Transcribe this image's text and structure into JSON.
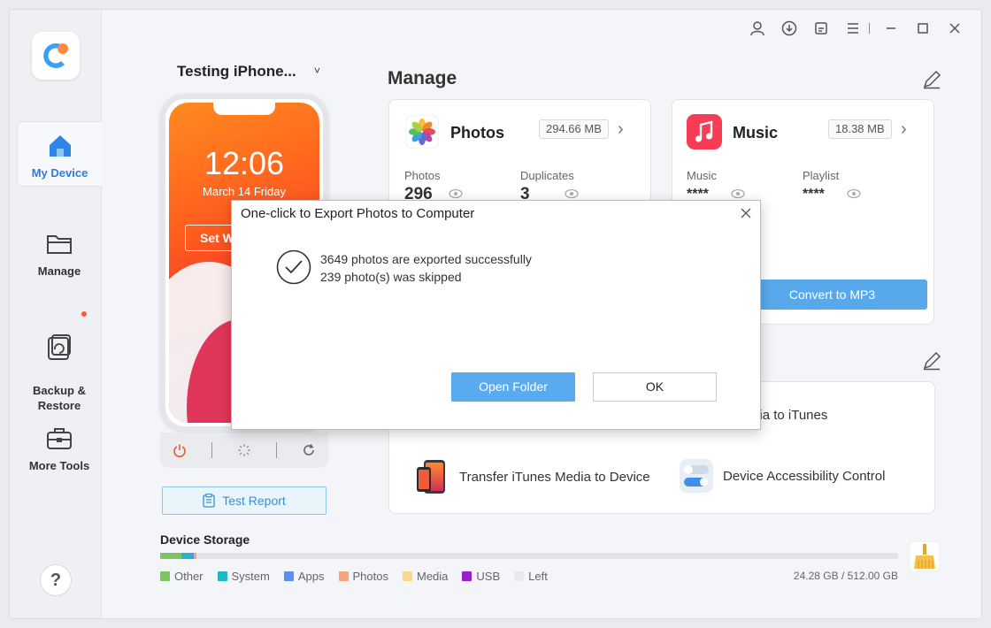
{
  "sidebar": {
    "logo_icon": "app-logo-icon",
    "items": [
      {
        "label": "My Device",
        "icon": "home-icon",
        "active": true
      },
      {
        "label": "Manage",
        "icon": "folder-icon"
      },
      {
        "label": "Backup &\nRestore",
        "icon": "backup-restore-icon",
        "badge": true
      },
      {
        "label": "More Tools",
        "icon": "toolbox-icon"
      }
    ],
    "help_label": "?"
  },
  "titlebar": {
    "icons": [
      "user-icon",
      "download-icon",
      "feedback-icon",
      "menu-icon",
      "minimize-icon",
      "maximize-icon",
      "close-icon"
    ]
  },
  "device": {
    "name": "Testing iPhone...",
    "caret": "˅",
    "time": "12:06",
    "date": "March 14 Friday",
    "screen_button": "Set W",
    "controls": [
      "power-icon",
      "loading-icon",
      "refresh-icon"
    ],
    "test_report_label": "Test Report"
  },
  "manage": {
    "title": "Manage",
    "photos_card": {
      "title": "Photos",
      "size": "294.66 MB",
      "stat1_label": "Photos",
      "stat1_value": "296",
      "stat2_label": "Duplicates",
      "stat2_value": "3"
    },
    "music_card": {
      "title": "Music",
      "size": "18.38 MB",
      "stat1_label": "Music",
      "stat1_value": "****",
      "stat2_label": "Playlist",
      "stat2_value": "****",
      "convert_label": "Convert to MP3"
    },
    "tools": {
      "t1": "r Device Media to iTunes",
      "t2": "Transfer iTunes Media to Device",
      "t3": "Device Accessibility Control"
    }
  },
  "storage": {
    "title": "Device Storage",
    "legend": [
      {
        "label": "Other",
        "color": "#7cc55f"
      },
      {
        "label": "System",
        "color": "#23b6c9"
      },
      {
        "label": "Apps",
        "color": "#5b8ef0"
      },
      {
        "label": "Photos",
        "color": "#f5a27f"
      },
      {
        "label": "Media",
        "color": "#f7d98a"
      },
      {
        "label": "USB",
        "color": "#9b1fc9"
      },
      {
        "label": "Left",
        "color": "#e8e9ec"
      }
    ],
    "total": "24.28 GB / 512.00 GB"
  },
  "dialog": {
    "title": "One-click to Export Photos to Computer",
    "message1": "3649 photos are exported successfully",
    "message2": "239 photo(s) was skipped",
    "open_folder_label": "Open Folder",
    "ok_label": "OK"
  }
}
